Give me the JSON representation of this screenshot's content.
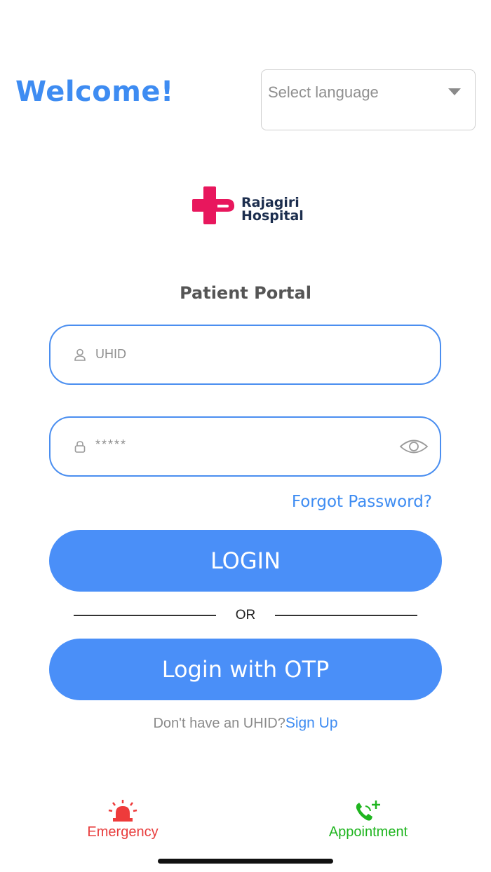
{
  "header": {
    "welcome": "Welcome!",
    "language_select": {
      "placeholder": "Select language"
    }
  },
  "logo": {
    "line1": "Rajagiri",
    "line2": "Hospital",
    "brand_color": "#e8175d"
  },
  "portal_title": "Patient Portal",
  "form": {
    "uhid": {
      "placeholder": "UHID",
      "icon": "user-icon"
    },
    "password": {
      "placeholder": "*****",
      "icon": "lock-icon",
      "toggle_icon": "eye-icon"
    },
    "forgot_password": "Forgot Password?",
    "login_button": "LOGIN",
    "separator": "OR",
    "otp_button": "Login with OTP",
    "signup_prompt": "Don't have an UHID?",
    "signup_link": "Sign Up"
  },
  "bottom_bar": {
    "emergency": {
      "label": "Emergency",
      "icon": "siren-icon",
      "color": "#e83d3d"
    },
    "appointment": {
      "label": "Appointment",
      "icon": "phone-add-icon",
      "color": "#1fb51f"
    }
  },
  "colors": {
    "accent": "#3e8cf2",
    "button": "#4a8ff8"
  }
}
